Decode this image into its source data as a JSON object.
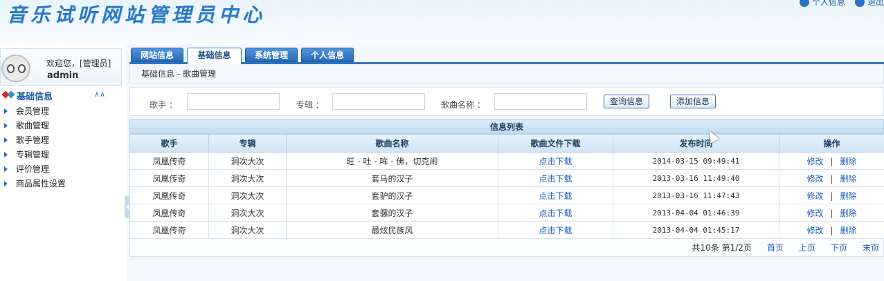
{
  "header": {
    "title": "音乐试听网站管理员中心",
    "links": [
      "个人信息",
      "退出"
    ]
  },
  "sidebar": {
    "welcome": "欢迎您，[管理员]",
    "username": "admin",
    "menu_title": "基础信息",
    "items": [
      {
        "label": "会员管理"
      },
      {
        "label": "歌曲管理"
      },
      {
        "label": "歌手管理"
      },
      {
        "label": "专辑管理"
      },
      {
        "label": "评价管理"
      },
      {
        "label": "商品属性设置"
      }
    ]
  },
  "tabs": [
    {
      "label": "网站信息",
      "active": false
    },
    {
      "label": "基础信息",
      "active": true
    },
    {
      "label": "系统管理",
      "active": false
    },
    {
      "label": "个人信息",
      "active": false
    }
  ],
  "breadcrumb": "基础信息 - 歌曲管理",
  "filter": {
    "singer_label": "歌手 ：",
    "album_label": "专辑 ：",
    "song_label": "歌曲名称 ：",
    "singer_value": "",
    "album_value": "",
    "song_value": "",
    "query_button": "查询信息",
    "add_button": "添加信息"
  },
  "table": {
    "title": "信息列表",
    "columns": [
      "歌手",
      "专辑",
      "歌曲名称",
      "歌曲文件下载",
      "发布时间",
      "操作"
    ],
    "rows": [
      {
        "singer": "凤凰传奇",
        "album": "洞次大次",
        "song": "旺 - 吐 - 哞 - 佛，切克闹",
        "download": "点击下载",
        "time": "2014-03-15 09:49:41",
        "edit": "修改",
        "delete": "删除"
      },
      {
        "singer": "凤凰传奇",
        "album": "洞次大次",
        "song": "套马的汉子",
        "download": "点击下载",
        "time": "2013-03-16 11:49:40",
        "edit": "修改",
        "delete": "删除"
      },
      {
        "singer": "凤凰传奇",
        "album": "洞次大次",
        "song": "套驴的汉子",
        "download": "点击下载",
        "time": "2013-03-16 11:47:43",
        "edit": "修改",
        "delete": "删除"
      },
      {
        "singer": "凤凰传奇",
        "album": "洞次大次",
        "song": "套骡的汉子",
        "download": "点击下载",
        "time": "2013-04-04 01:46:39",
        "edit": "修改",
        "delete": "删除"
      },
      {
        "singer": "凤凰传奇",
        "album": "洞次大次",
        "song": "最炫民族风",
        "download": "点击下载",
        "time": "2013-04-04 01:45:17",
        "edit": "修改",
        "delete": "删除"
      }
    ],
    "action_separator": "|"
  },
  "pager": {
    "info": "共10条 第1/2页",
    "first": "首页",
    "prev": "上页",
    "next": "下页",
    "last": "末页"
  },
  "colors": {
    "accent": "#2f75c0",
    "link": "#1a5fc0",
    "title": "#2a79c4"
  }
}
